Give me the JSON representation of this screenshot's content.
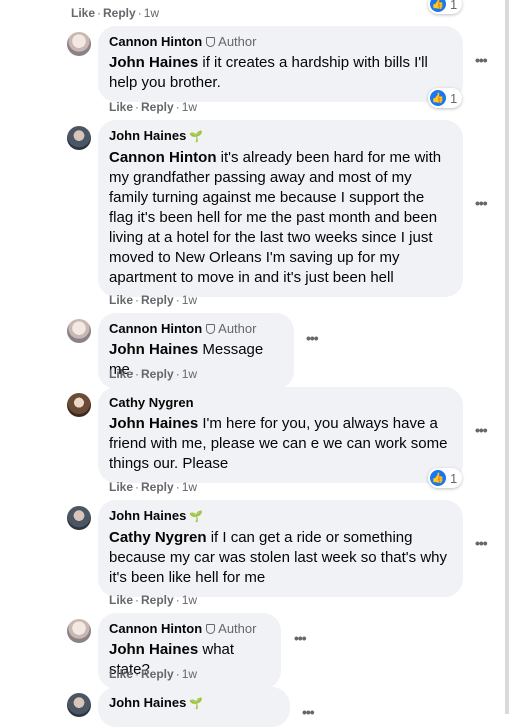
{
  "action_labels": {
    "like": "Like",
    "reply": "Reply",
    "sep": "·"
  },
  "comments": [
    {
      "id": "top",
      "time": "1w",
      "reactions": "1"
    },
    {
      "author": "Cannon Hinton",
      "author_badge": "Author",
      "mention": "John Haines",
      "text": " if it creates a hardship with bills I'll help you brother.",
      "time": "1w",
      "reactions": "1"
    },
    {
      "author": "John Haines",
      "mention": "Cannon Hinton",
      "text": " it's already been hard for me with my grandfather passing away and most of my family turning against me because I support the flag it's been hell for me the past month and been living at a hotel for the last two weeks since I just moved to New Orleans I'm saving up for my apartment to move in and it's just been hell",
      "time": "1w"
    },
    {
      "author": "Cannon Hinton",
      "author_badge": "Author",
      "mention": "John Haines",
      "text": " Message me.",
      "time": "1w"
    },
    {
      "author": "Cathy Nygren",
      "mention": "John Haines",
      "text": " I'm here for you, you always have a friend with me, please we can e we can work some things our. Please",
      "time": "1w",
      "reactions": "1"
    },
    {
      "author": "John Haines",
      "mention": "Cathy Nygren",
      "text": " if I can get a ride or something because my car was stolen last week so that's why it's been like hell for me",
      "time": "1w"
    },
    {
      "author": "Cannon Hinton",
      "author_badge": "Author",
      "mention": "John Haines",
      "text": " what state?",
      "time": "1w"
    },
    {
      "author": "John Haines"
    }
  ]
}
